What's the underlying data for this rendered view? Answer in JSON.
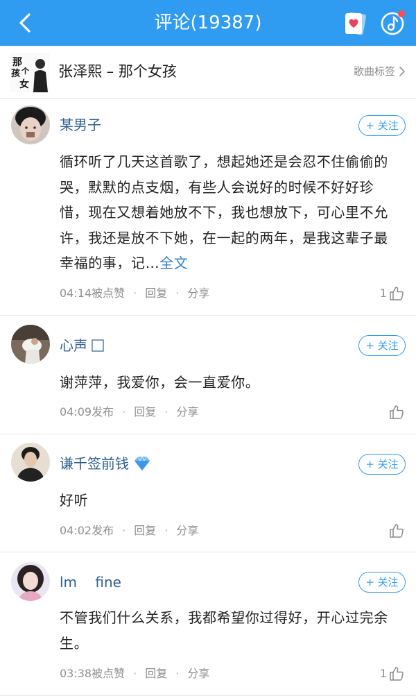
{
  "header": {
    "title": "评论(19387)"
  },
  "song": {
    "cover_text": "那个女孩",
    "title": "张泽熙 – 那个女孩",
    "tag_label": "歌曲标签"
  },
  "comments": [
    {
      "username": "某男子",
      "follow_label": "+ 关注",
      "text": "循环听了几天这首歌了，想起她还是会忍不住偷偷的哭，默默的点支烟，有些人会说好的时候不好好珍惜，现在又想着她放不下，我也想放下，可心里不允许，我还是放不下她，在一起的两年，是我这辈子最幸福的事，记…",
      "more_label": "全文",
      "time": "04:14被点赞",
      "reply_label": "回复",
      "share_label": "分享",
      "likes": "1"
    },
    {
      "username": "心声",
      "follow_label": "+ 关注",
      "text": "谢萍萍，我爱你，会一直爱你。",
      "time": "04:09发布",
      "reply_label": "回复",
      "share_label": "分享",
      "likes": ""
    },
    {
      "username": "谦千签前钱",
      "follow_label": "+ 关注",
      "text": "好听",
      "time": "04:02发布",
      "reply_label": "回复",
      "share_label": "分享",
      "likes": ""
    },
    {
      "username": "lm　 fine",
      "follow_label": "+ 关注",
      "text": "不管我们什么关系，我都希望你过得好，开心过完余生。",
      "time": "03:38被点赞",
      "reply_label": "回复",
      "share_label": "分享",
      "likes": "1"
    }
  ],
  "colors": {
    "header_bg": "#2f9cf1",
    "username": "#2f5f8f",
    "accent": "#2f9cf1",
    "meta": "#8f8f8f"
  },
  "icons": {
    "back": "chevron-left-icon",
    "card": "heart-card-icon",
    "music": "music-note-icon",
    "like": "thumb-up-icon",
    "tag_arrow": "chevron-right-icon",
    "vip": "diamond-icon"
  }
}
